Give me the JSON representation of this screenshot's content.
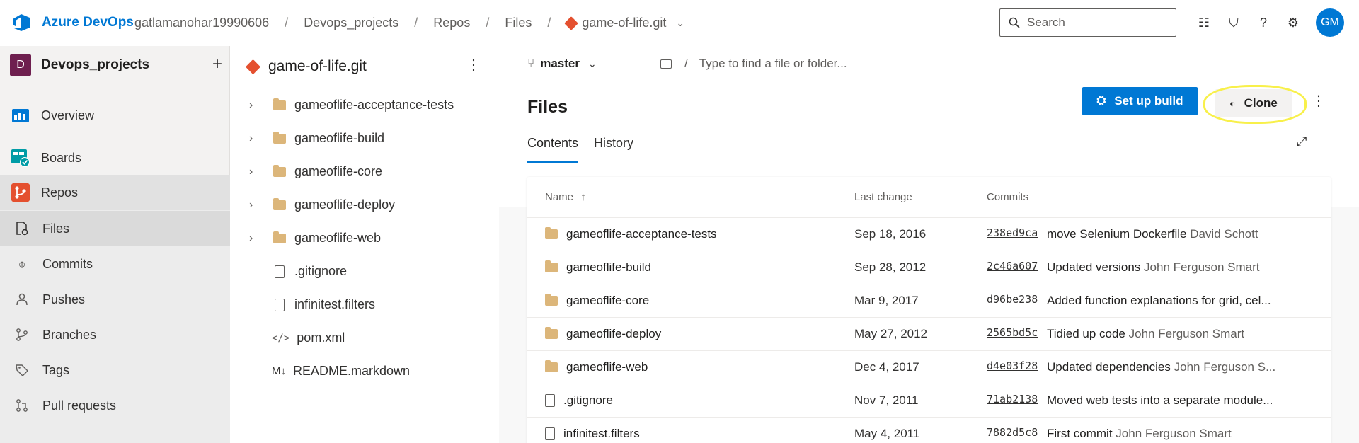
{
  "topbar": {
    "brand": "Azure DevOps",
    "breadcrumbs": [
      "gatlamanohar19990606",
      "Devops_projects",
      "Repos",
      "Files",
      "game-of-life.git"
    ],
    "search_placeholder": "Search",
    "avatar_initials": "GM"
  },
  "sidebar": {
    "project_initial": "D",
    "project_name": "Devops_projects",
    "items": [
      {
        "label": "Overview",
        "icon": "overview-icon"
      },
      {
        "label": "Boards",
        "icon": "boards-icon"
      },
      {
        "label": "Repos",
        "icon": "repos-icon"
      }
    ],
    "repo_items": [
      {
        "label": "Files",
        "icon": "files-icon"
      },
      {
        "label": "Commits",
        "icon": "commits-icon"
      },
      {
        "label": "Pushes",
        "icon": "pushes-icon"
      },
      {
        "label": "Branches",
        "icon": "branches-icon"
      },
      {
        "label": "Tags",
        "icon": "tags-icon"
      },
      {
        "label": "Pull requests",
        "icon": "pull-requests-icon"
      }
    ]
  },
  "tree": {
    "repo_name": "game-of-life.git",
    "entries": [
      {
        "name": "gameoflife-acceptance-tests",
        "kind": "folder"
      },
      {
        "name": "gameoflife-build",
        "kind": "folder"
      },
      {
        "name": "gameoflife-core",
        "kind": "folder"
      },
      {
        "name": "gameoflife-deploy",
        "kind": "folder"
      },
      {
        "name": "gameoflife-web",
        "kind": "folder"
      },
      {
        "name": ".gitignore",
        "kind": "file"
      },
      {
        "name": "infinitest.filters",
        "kind": "file"
      },
      {
        "name": "pom.xml",
        "kind": "code"
      },
      {
        "name": "README.markdown",
        "kind": "markdown"
      }
    ]
  },
  "main": {
    "branch": "master",
    "path_placeholder": "Type to find a file or folder...",
    "title": "Files",
    "setup_build_label": "Set up build",
    "clone_label": "Clone",
    "tabs": [
      "Contents",
      "History"
    ],
    "columns": {
      "name": "Name",
      "sort_indicator": "↑",
      "last_change": "Last change",
      "commits": "Commits"
    },
    "rows": [
      {
        "name": "gameoflife-acceptance-tests",
        "kind": "folder",
        "date": "Sep 18, 2016",
        "hash": "238ed9ca",
        "message": "move Selenium Dockerfile",
        "author": "David Schott"
      },
      {
        "name": "gameoflife-build",
        "kind": "folder",
        "date": "Sep 28, 2012",
        "hash": "2c46a607",
        "message": "Updated versions",
        "author": "John Ferguson Smart"
      },
      {
        "name": "gameoflife-core",
        "kind": "folder",
        "date": "Mar 9, 2017",
        "hash": "d96be238",
        "message": "Added function explanations for grid, cel...",
        "author": ""
      },
      {
        "name": "gameoflife-deploy",
        "kind": "folder",
        "date": "May 27, 2012",
        "hash": "2565bd5c",
        "message": "Tidied up code",
        "author": "John Ferguson Smart"
      },
      {
        "name": "gameoflife-web",
        "kind": "folder",
        "date": "Dec 4, 2017",
        "hash": "d4e03f28",
        "message": "Updated dependencies",
        "author": "John Ferguson S..."
      },
      {
        "name": ".gitignore",
        "kind": "file",
        "date": "Nov 7, 2011",
        "hash": "71ab2138",
        "message": "Moved web tests into a separate module...",
        "author": ""
      },
      {
        "name": "infinitest.filters",
        "kind": "file",
        "date": "May 4, 2011",
        "hash": "7882d5c8",
        "message": "First commit",
        "author": "John Ferguson Smart"
      }
    ]
  },
  "colors": {
    "accent": "#0078d4",
    "git": "#e4502f",
    "folder": "#dcb67a",
    "highlight": "#f8f04a"
  }
}
